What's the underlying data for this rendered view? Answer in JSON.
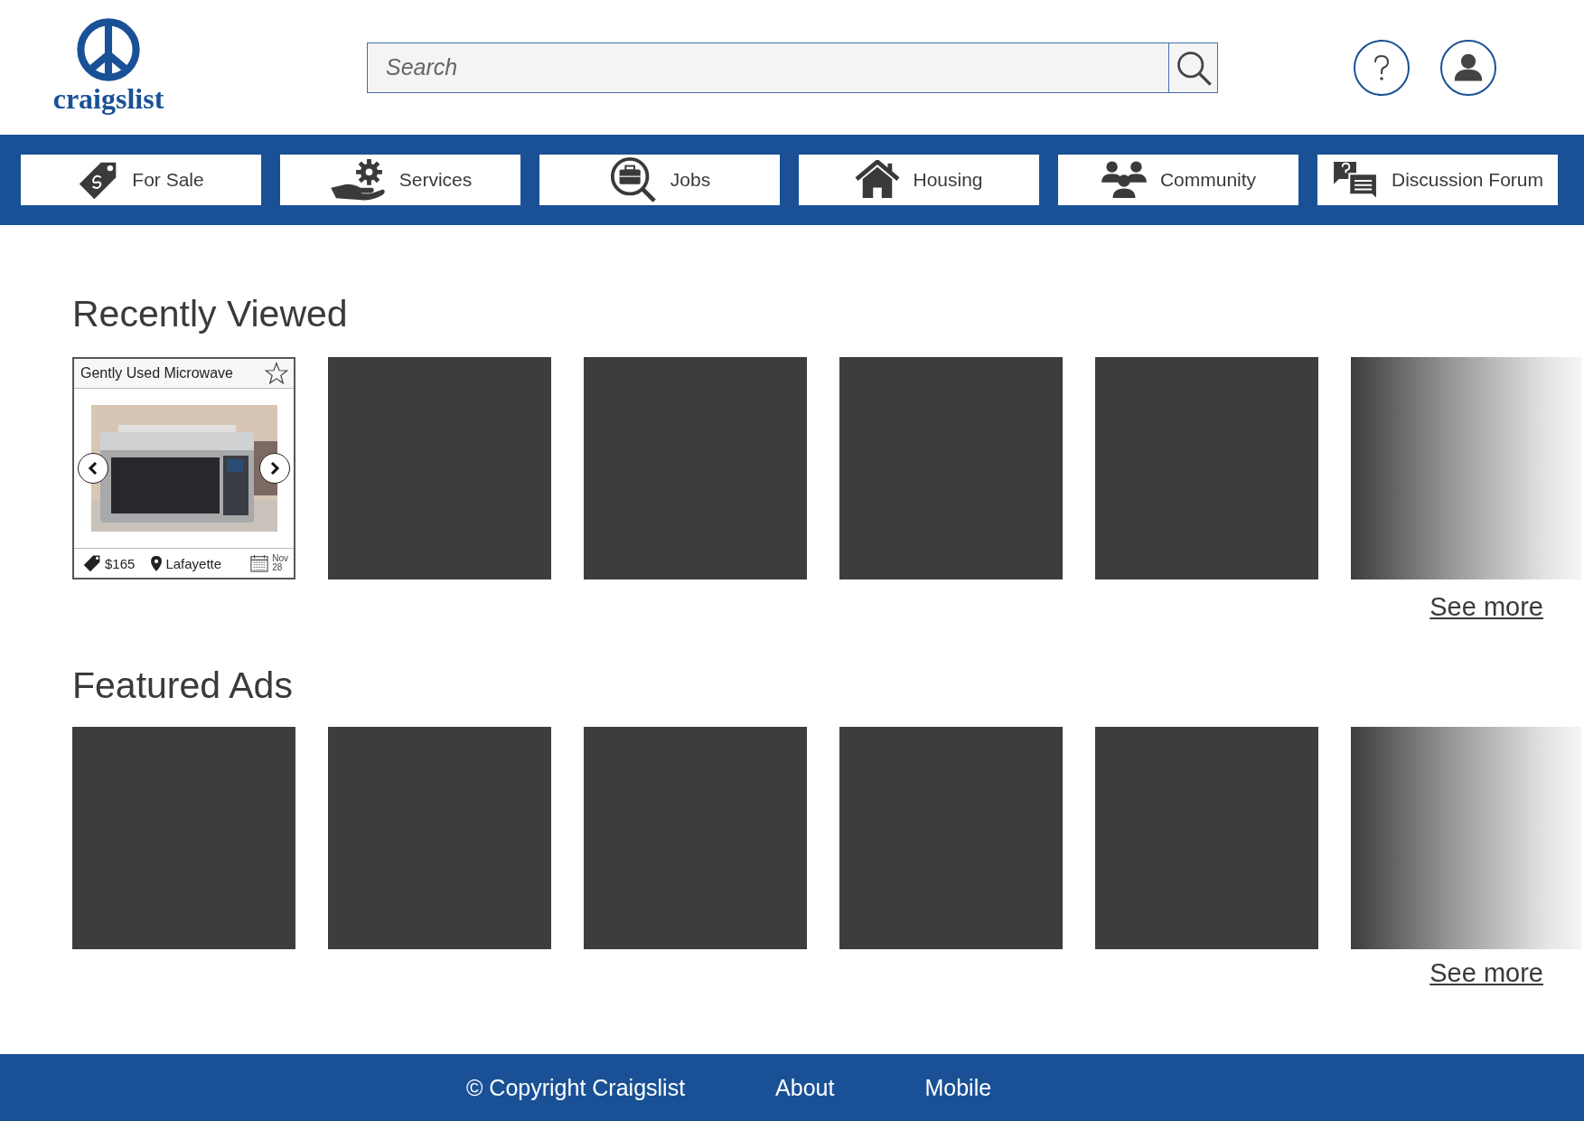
{
  "logo": {
    "text": "craigslist"
  },
  "search": {
    "placeholder": "Search"
  },
  "nav": [
    {
      "label": "For Sale",
      "kind": "tag"
    },
    {
      "label": "Services",
      "kind": "service"
    },
    {
      "label": "Jobs",
      "kind": "jobs"
    },
    {
      "label": "Housing",
      "kind": "house"
    },
    {
      "label": "Community",
      "kind": "people"
    },
    {
      "label": "Discussion Forum",
      "kind": "chat"
    }
  ],
  "sections": [
    {
      "title": "Recently Viewed",
      "see_more": "See more",
      "items": [
        {
          "kind": "listing",
          "title": "Gently Used Microwave",
          "starred": false,
          "price": "$165",
          "location": "Lafayette",
          "date_month": "Nov",
          "date_day": "28"
        },
        {
          "kind": "blank"
        },
        {
          "kind": "blank"
        },
        {
          "kind": "blank"
        },
        {
          "kind": "blank"
        },
        {
          "kind": "fade"
        }
      ]
    },
    {
      "title": "Featured Ads",
      "see_more": "See more",
      "items": [
        {
          "kind": "blank"
        },
        {
          "kind": "blank"
        },
        {
          "kind": "blank"
        },
        {
          "kind": "blank"
        },
        {
          "kind": "blank"
        },
        {
          "kind": "fade"
        }
      ]
    }
  ],
  "footer": {
    "copyright_symbol": "©",
    "copyright": "Copyright Craigslist",
    "links": [
      "About",
      "Mobile"
    ]
  }
}
